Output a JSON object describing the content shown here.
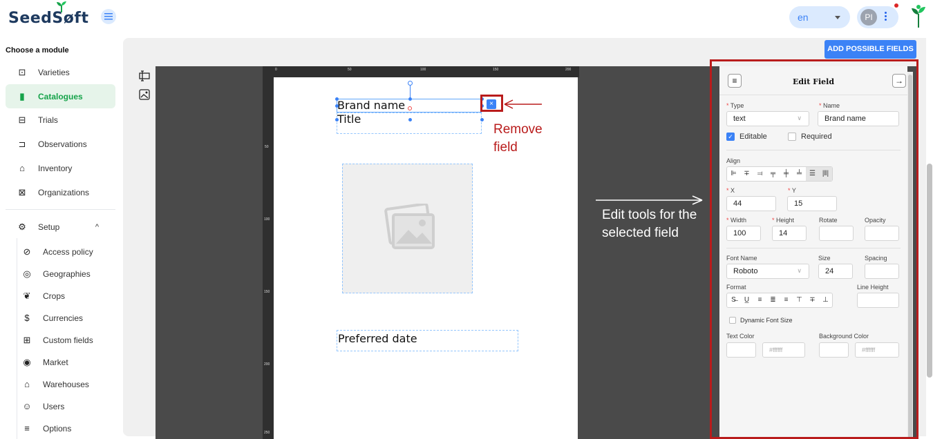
{
  "app": {
    "logo_text": "SeedSøft"
  },
  "header": {
    "language": "en",
    "user_initials": "PI"
  },
  "sidebar": {
    "title": "Choose a module",
    "items": [
      {
        "label": "Varieties",
        "icon": "varieties-icon"
      },
      {
        "label": "Catalogues",
        "icon": "catalogue-icon",
        "active": true
      },
      {
        "label": "Trials",
        "icon": "trials-icon"
      },
      {
        "label": "Observations",
        "icon": "observations-icon"
      },
      {
        "label": "Inventory",
        "icon": "inventory-icon"
      },
      {
        "label": "Organizations",
        "icon": "organizations-icon"
      }
    ],
    "setup": {
      "label": "Setup",
      "icon": "gear-icon"
    },
    "setup_items": [
      {
        "label": "Access policy"
      },
      {
        "label": "Geographies"
      },
      {
        "label": "Crops"
      },
      {
        "label": "Currencies"
      },
      {
        "label": "Custom fields"
      },
      {
        "label": "Market"
      },
      {
        "label": "Warehouses"
      },
      {
        "label": "Users"
      },
      {
        "label": "Options"
      }
    ]
  },
  "toolbar": {
    "add_fields_label": "ADD POSSIBLE FIELDS"
  },
  "ruler": {
    "top_ticks": [
      "0",
      "50",
      "100",
      "150",
      "200"
    ],
    "left_ticks": [
      "50",
      "100",
      "150",
      "200",
      "250"
    ]
  },
  "canvas": {
    "fields": {
      "brand": "Brand name",
      "title": "Title",
      "date": "Preferred date"
    },
    "remove_symbol": "×"
  },
  "annotations": {
    "remove": [
      "Remove",
      "field"
    ],
    "edit": "Edit tools for the selected field"
  },
  "edit_panel": {
    "title": "Edit Field",
    "type_label": "Type",
    "type_value": "text",
    "name_label": "Name",
    "name_value": "Brand name",
    "editable_label": "Editable",
    "required_label": "Required",
    "align_label": "Align",
    "x_label": "X",
    "x_value": "44",
    "y_label": "Y",
    "y_value": "15",
    "width_label": "Width",
    "width_value": "100",
    "height_label": "Height",
    "height_value": "14",
    "rotate_label": "Rotate",
    "opacity_label": "Opacity",
    "font_name_label": "Font Name",
    "font_name_value": "Roboto",
    "size_label": "Size",
    "size_value": "24",
    "spacing_label": "Spacing",
    "format_label": "Format",
    "line_height_label": "Line Height",
    "dynamic_font_label": "Dynamic Font Size",
    "text_color_label": "Text Color",
    "text_color_value": "#ffffff",
    "bg_color_label": "Background Color",
    "bg_color_value": "#ffffff",
    "align_buttons": [
      "⊫",
      "∓",
      "⫤",
      "╤",
      "╪",
      "╧",
      "☰",
      "|‖|"
    ],
    "format_buttons": [
      "S̶",
      "U̲",
      "≡",
      "≣",
      "≡",
      "⊤",
      "∓",
      "⊥"
    ]
  },
  "colors": {
    "accent": "#3b82f6",
    "active_green": "#16a34a",
    "annotation_red": "#b91c1c"
  }
}
